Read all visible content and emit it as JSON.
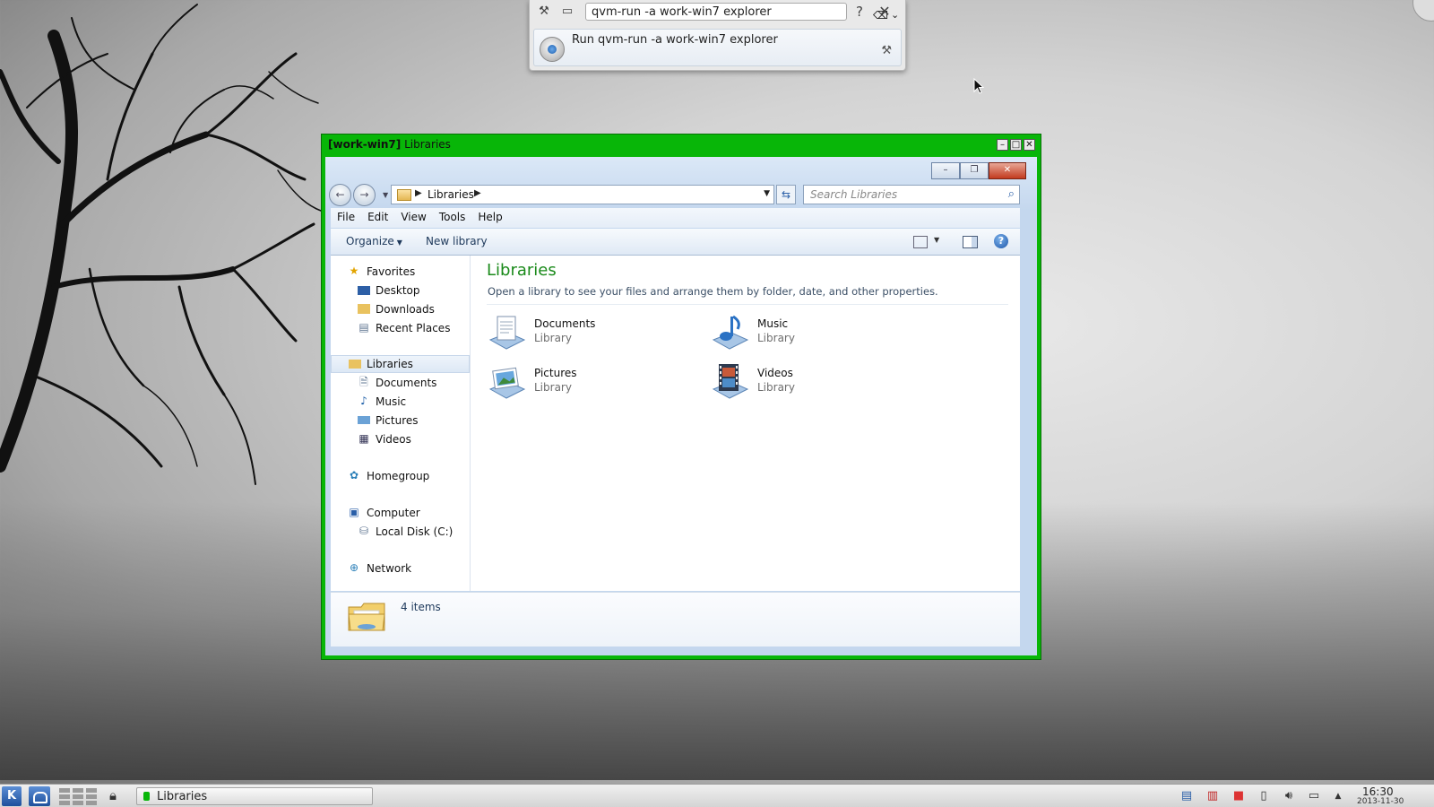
{
  "krunner": {
    "query": "qvm-run -a work-win7 explorer",
    "result": "Run qvm-run -a work-win7 explorer",
    "help": "?",
    "close": "✕"
  },
  "vm_window": {
    "title_prefix": "[work-win7]",
    "title": "Libraries",
    "border_color": "#08b608"
  },
  "explorer": {
    "address": "Libraries",
    "search_placeholder": "Search Libraries",
    "menu": [
      "File",
      "Edit",
      "View",
      "Tools",
      "Help"
    ],
    "commands": {
      "organize": "Organize",
      "new_library": "New library"
    },
    "nav": {
      "favorites": "Favorites",
      "desktop": "Desktop",
      "downloads": "Downloads",
      "recent": "Recent Places",
      "libraries": "Libraries",
      "documents": "Documents",
      "music": "Music",
      "pictures": "Pictures",
      "videos": "Videos",
      "homegroup": "Homegroup",
      "computer": "Computer",
      "local_disk": "Local Disk (C:)",
      "network": "Network"
    },
    "content": {
      "title": "Libraries",
      "subtitle": "Open a library to see your files and arrange them by folder, date, and other properties.",
      "items": [
        {
          "name": "Documents",
          "kind": "Library"
        },
        {
          "name": "Music",
          "kind": "Library"
        },
        {
          "name": "Pictures",
          "kind": "Library"
        },
        {
          "name": "Videos",
          "kind": "Library"
        }
      ]
    },
    "status": "4 items"
  },
  "taskbar": {
    "task_label": "Libraries",
    "time": "16:30",
    "date": "2013-11-30"
  }
}
